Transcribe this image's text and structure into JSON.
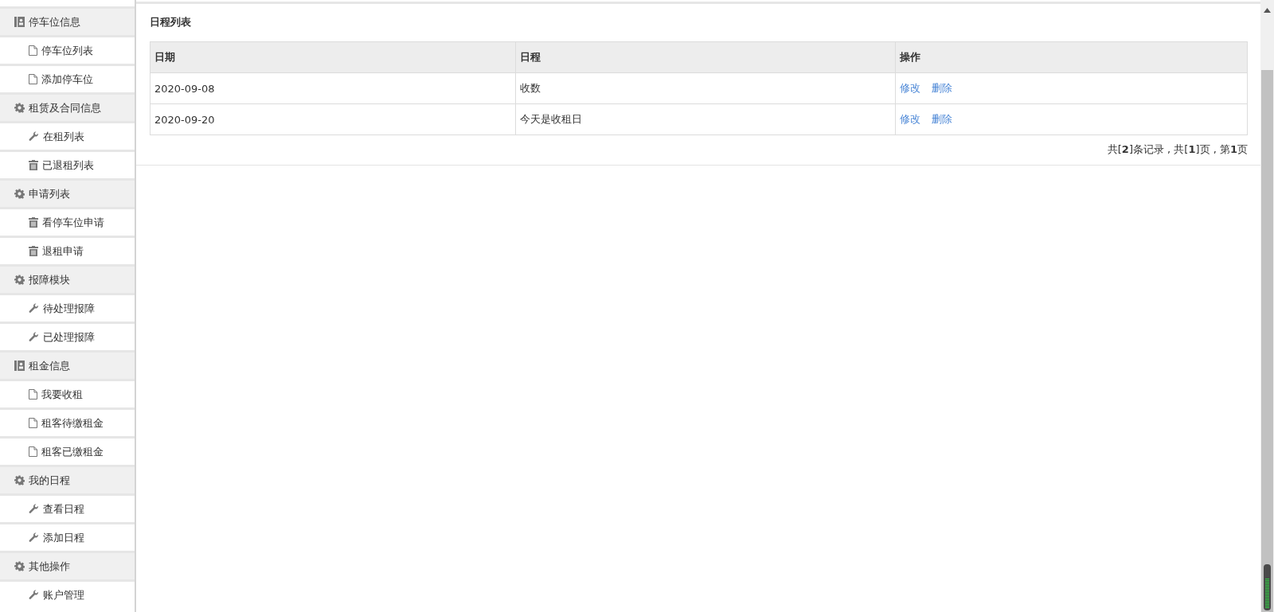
{
  "sidebar": {
    "groups": [
      {
        "label": "停车位信息",
        "items": [
          {
            "label": "停车位列表"
          },
          {
            "label": "添加停车位"
          }
        ]
      },
      {
        "label": "租赁及合同信息",
        "items": [
          {
            "label": "在租列表"
          },
          {
            "label": "已退租列表"
          }
        ]
      },
      {
        "label": "申请列表",
        "items": [
          {
            "label": "看停车位申请"
          },
          {
            "label": "退租申请"
          }
        ]
      },
      {
        "label": "报障模块",
        "items": [
          {
            "label": "待处理报障"
          },
          {
            "label": "已处理报障"
          }
        ]
      },
      {
        "label": "租金信息",
        "items": [
          {
            "label": "我要收租"
          },
          {
            "label": "租客待缴租金"
          },
          {
            "label": "租客已缴租金"
          }
        ]
      },
      {
        "label": "我的日程",
        "items": [
          {
            "label": "查看日程"
          },
          {
            "label": "添加日程"
          }
        ]
      },
      {
        "label": "其他操作",
        "items": [
          {
            "label": "账户管理"
          }
        ]
      }
    ]
  },
  "panel": {
    "title": "日程列表",
    "table": {
      "columns": [
        "日期",
        "日程",
        "操作"
      ],
      "rows": [
        {
          "date": "2020-09-08",
          "schedule": "收数",
          "actions": [
            "修改",
            "删除"
          ]
        },
        {
          "date": "2020-09-20",
          "schedule": "今天是收租日",
          "actions": [
            "修改",
            "删除"
          ]
        }
      ]
    },
    "pagination": "共[**2**]条记录 , 共[**1**]页 , 第**1**页"
  }
}
